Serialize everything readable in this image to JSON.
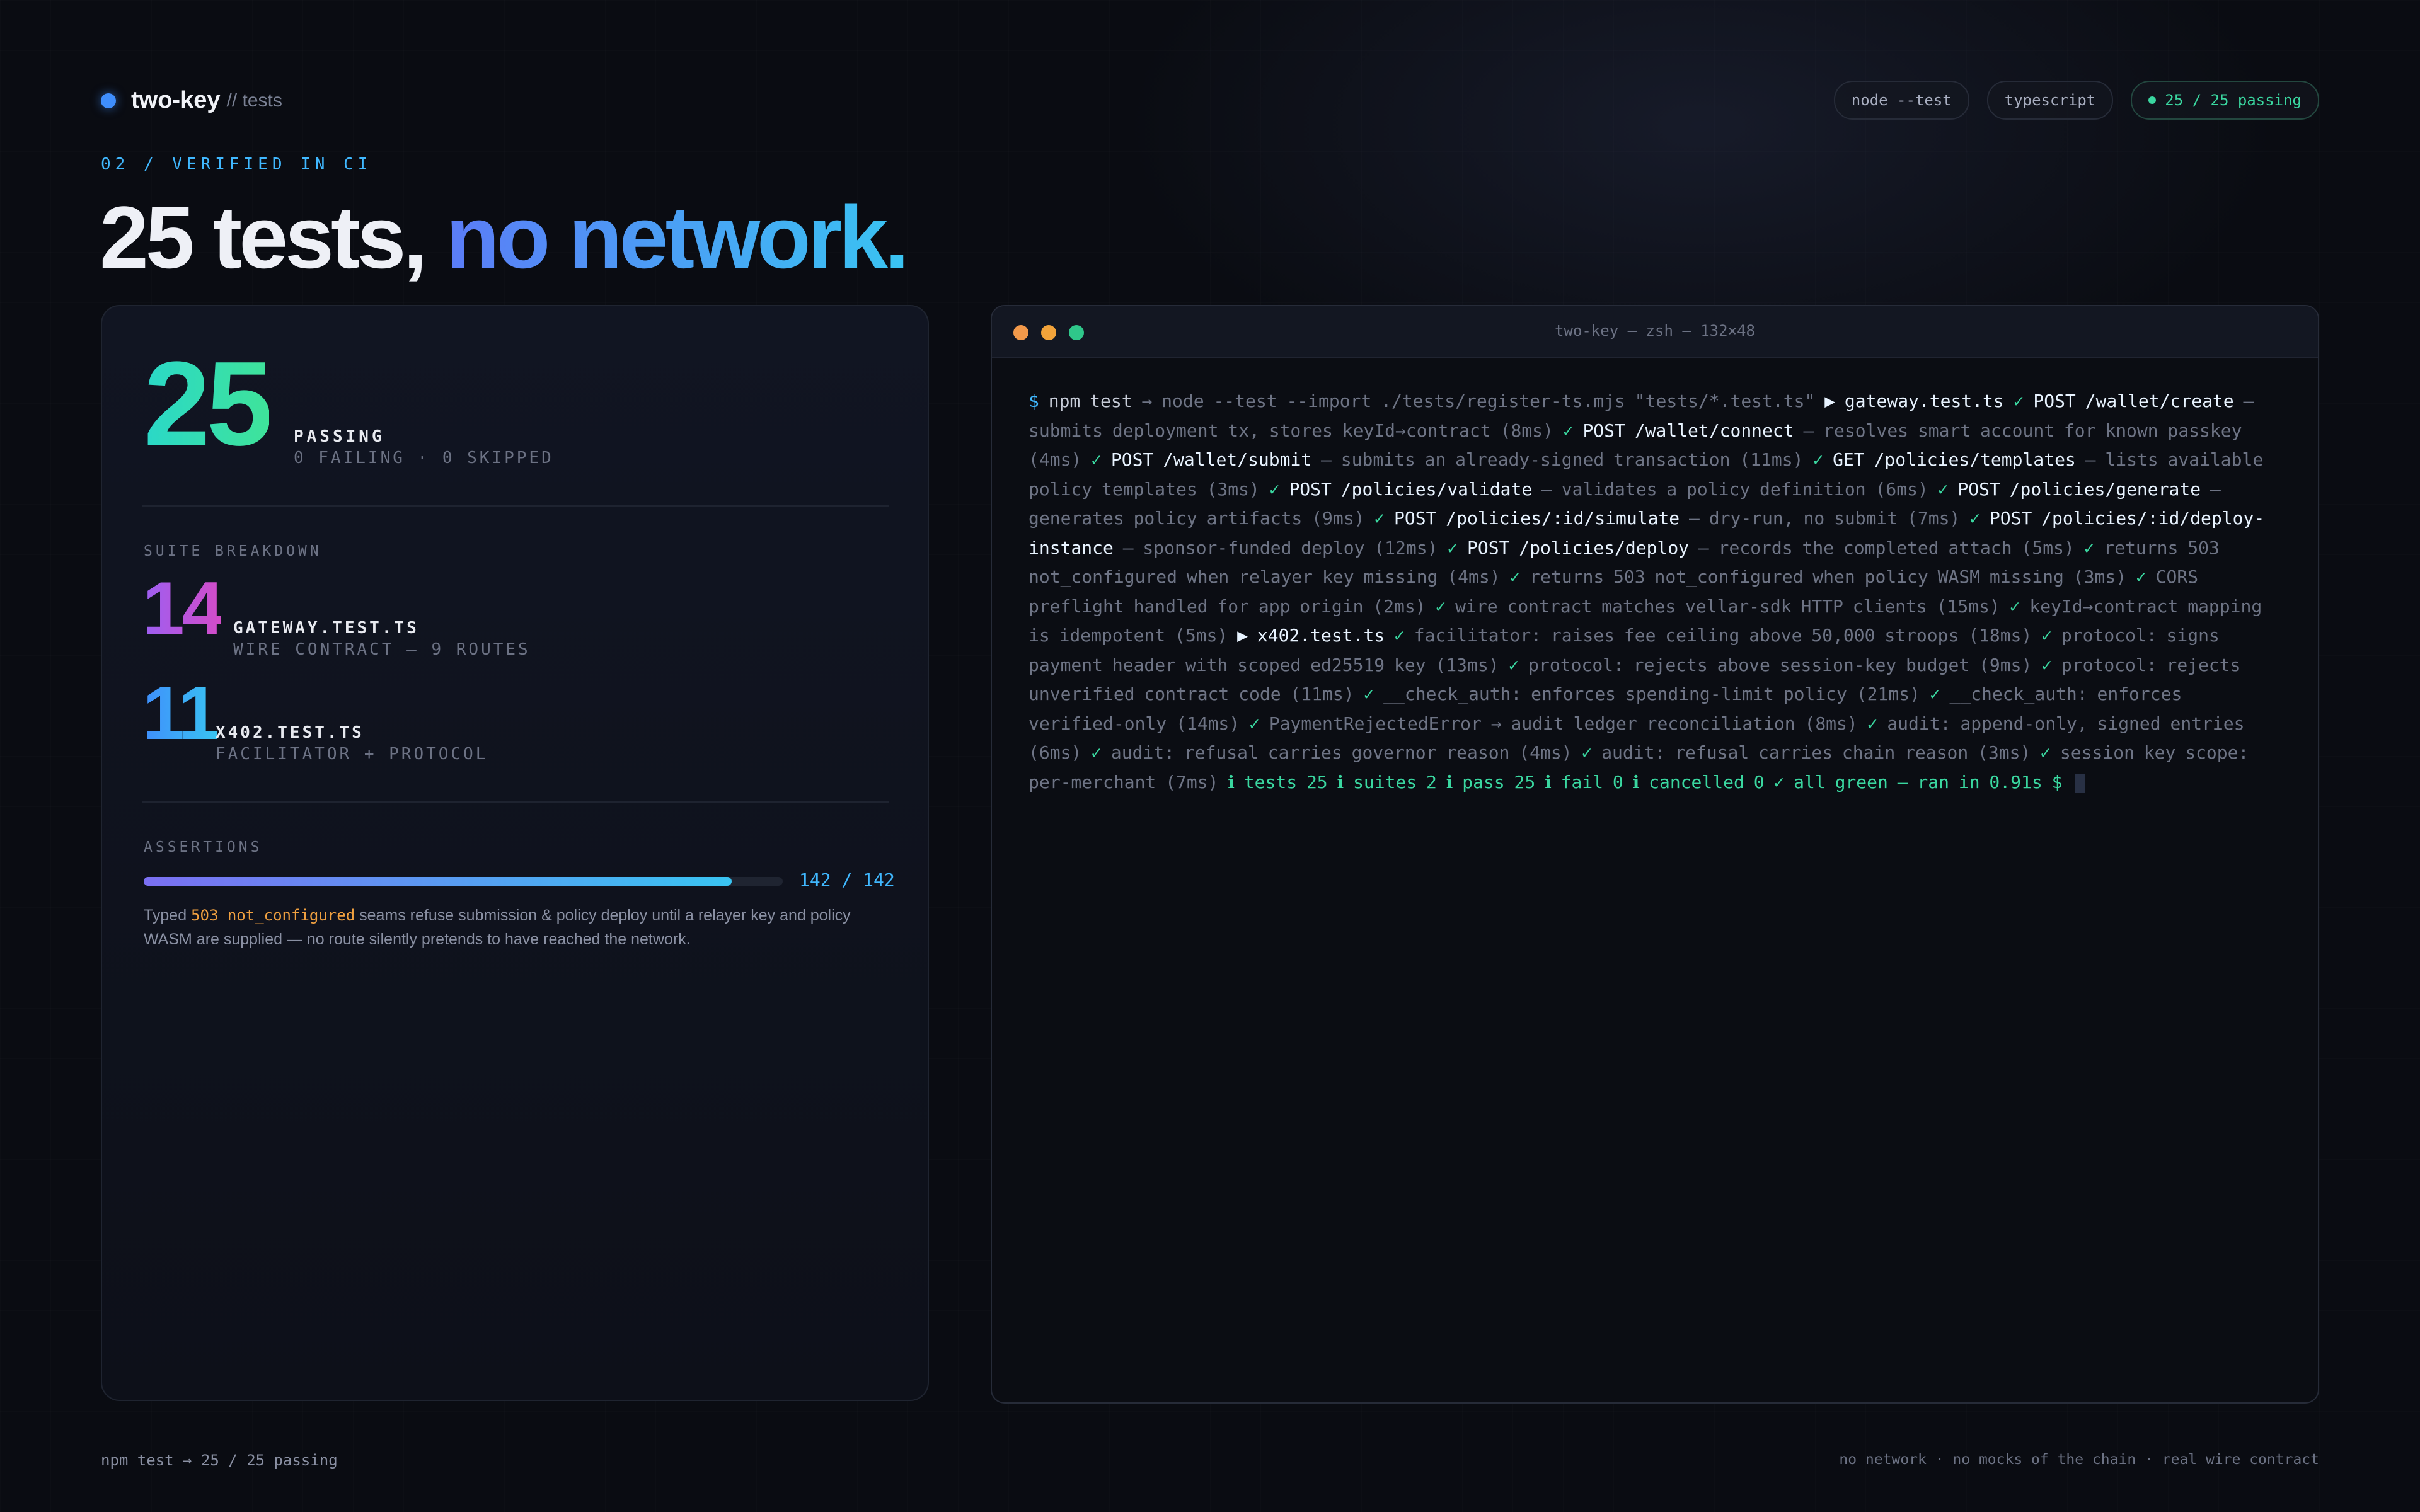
{
  "brand": {
    "name": "two-key",
    "sub": "// tests",
    "color": "#3f8efc"
  },
  "pills": {
    "runner": "node --test",
    "lang": "typescript",
    "status": "25 / 25 passing"
  },
  "eyebrow": "02 / VERIFIED IN CI",
  "headline": {
    "lead": "25 tests,",
    "accent": "no network."
  },
  "summary": {
    "passing_count": "25",
    "passing_label": "PASSING",
    "failing_label": "0 FAILING · 0 SKIPPED",
    "breakdown_label": "SUITE BREAKDOWN",
    "suites": [
      {
        "count": "14",
        "name": "GATEWAY.TEST.TS",
        "desc": "WIRE CONTRACT — 9 ROUTES"
      },
      {
        "count": "11",
        "name": "X402.TEST.TS",
        "desc": "FACILITATOR + PROTOCOL"
      }
    ],
    "assertions_label": "ASSERTIONS",
    "assertions_count": "142 / 142",
    "assertions_fraction": 0.92,
    "note_pre": "Typed ",
    "note_code": "503 not_configured",
    "note_post": " seams refuse submission & policy deploy until a relayer key and policy WASM are supplied — no route silently pretends to have reached the network."
  },
  "terminal": {
    "title": "two-key — zsh — 132×48",
    "lights": [
      "#f2994a",
      "#f2a33a",
      "#2fc78a"
    ],
    "prompt": "$",
    "command": "npm test",
    "arrow": "→",
    "invoke": "node --test --import ./tests/register-ts.mjs \"tests/*.test.ts\"",
    "file_marker": "▶",
    "check": "✓",
    "files": [
      {
        "file": "gateway.test.ts",
        "tests": [
          {
            "route": "POST /wallet/create",
            "desc": "— submits deployment tx, stores keyId→contract (8ms)"
          },
          {
            "route": "POST /wallet/connect",
            "desc": "— resolves smart account for known passkey (4ms)"
          },
          {
            "route": "POST /wallet/submit",
            "desc": "— submits an already-signed transaction (11ms)"
          },
          {
            "route": "GET /policies/templates",
            "desc": "— lists available policy templates (3ms)"
          },
          {
            "route": "POST /policies/validate",
            "desc": "— validates a policy definition (6ms)"
          },
          {
            "route": "POST /policies/generate",
            "desc": "— generates policy artifacts (9ms)"
          },
          {
            "route": "POST /policies/:id/simulate",
            "desc": "— dry-run, no submit (7ms)"
          },
          {
            "route": "POST /policies/:id/deploy-instance",
            "desc": "— sponsor-funded deploy (12ms)"
          },
          {
            "route": "POST /policies/deploy",
            "desc": "— records the completed attach (5ms)"
          },
          {
            "route": "",
            "desc": "returns 503 not_configured when relayer key missing (4ms)"
          },
          {
            "route": "",
            "desc": "returns 503 not_configured when policy WASM missing (3ms)"
          },
          {
            "route": "",
            "desc": "CORS preflight handled for app origin (2ms)"
          },
          {
            "route": "",
            "desc": "wire contract matches vellar-sdk HTTP clients (15ms)"
          },
          {
            "route": "",
            "desc": "keyId→contract mapping is idempotent (5ms)"
          }
        ]
      },
      {
        "file": "x402.test.ts",
        "tests": [
          {
            "route": "",
            "desc": "facilitator: raises fee ceiling above 50,000 stroops (18ms)"
          },
          {
            "route": "",
            "desc": "protocol: signs payment header with scoped ed25519 key (13ms)"
          },
          {
            "route": "",
            "desc": "protocol: rejects above session-key budget (9ms)"
          },
          {
            "route": "",
            "desc": "protocol: rejects unverified contract code (11ms)"
          },
          {
            "route": "",
            "desc": "__check_auth: enforces spending-limit policy (21ms)"
          },
          {
            "route": "",
            "desc": "__check_auth: enforces verified-only (14ms)"
          },
          {
            "route": "",
            "desc": "PaymentRejectedError → audit ledger reconciliation (8ms)"
          },
          {
            "route": "",
            "desc": "audit: append-only, signed entries (6ms)"
          },
          {
            "route": "",
            "desc": "audit: refusal carries governor reason (4ms)"
          },
          {
            "route": "",
            "desc": "audit: refusal carries chain reason (3ms)"
          },
          {
            "route": "",
            "desc": "session key scope: per-merchant (7ms)"
          }
        ]
      }
    ],
    "info_marker": "ℹ",
    "stats": [
      "tests 25",
      "suites 2",
      "pass 25",
      "fail 0",
      "cancelled 0"
    ],
    "final": "✓ all green — ran in 0.91s",
    "prompt_end": "$"
  },
  "footer": {
    "left": "npm test → 25 / 25 passing",
    "right": "no network · no mocks of the chain · real wire contract"
  }
}
